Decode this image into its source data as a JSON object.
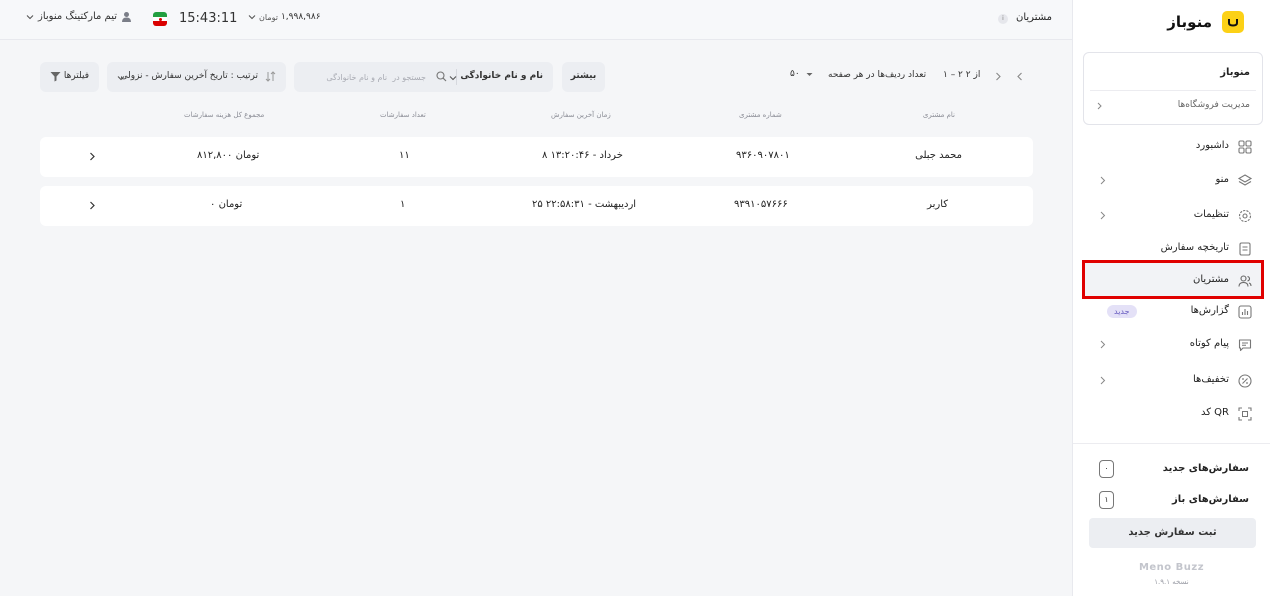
{
  "topbar": {
    "page_title": "مشتریان",
    "info_badge": "i",
    "user_name": "تیم مارکتینگ منوباز",
    "balance_value": "۱,۹۹۸,۹۸۶",
    "balance_unit": "تومان",
    "clock": "15:43:11"
  },
  "sidebar": {
    "logo_text": "منوباز",
    "store_name": "منوباز",
    "store_manage": "مدیریت فروشگاه‌ها",
    "nav": [
      {
        "label": "داشبورد",
        "icon": "dashboard-grid-icon"
      },
      {
        "label": "منو",
        "icon": "layers-icon"
      },
      {
        "label": "تنظیمات",
        "icon": "gear-icon"
      },
      {
        "label": "تاریخچه سفارش",
        "icon": "receipt-icon"
      },
      {
        "label": "مشتریان",
        "icon": "users-icon"
      },
      {
        "label": "گزارش‌ها",
        "icon": "bar-chart-icon",
        "badge": "جدید"
      },
      {
        "label": "پیام کوتاه",
        "icon": "message-icon"
      },
      {
        "label": "تخفیف‌ها",
        "icon": "discount-icon"
      },
      {
        "label": "کد QR",
        "icon": "qr-scan-icon"
      }
    ],
    "new_orders_label": "سفارش‌های جدید",
    "new_orders_count": "۰",
    "open_orders_label": "سفارش‌های باز",
    "open_orders_count": "۱",
    "new_order_button": "ثبت سفارش جدید",
    "brand_footer": "Meno Buzz",
    "version": "نسخه ۱.۹.۱"
  },
  "toolbar": {
    "filters_label": "فیلترها",
    "sort_label": "ترتیب : تاریخ آخرین سفارش - نزولی",
    "search_placeholder": "جستجو در  نام و نام خانوادگی",
    "search_field": "نام و نام خانوادگی",
    "more_label": "بیشتر",
    "pager_range": "۱ – ۲ از ۲",
    "rows_per_page_label": "تعداد ردیف‌ها در هر صفحه",
    "rows_per_page_value": "۵۰"
  },
  "table": {
    "headers": [
      "نام مشتری",
      "شماره مشتری",
      "زمان آخرین سفارش",
      "تعداد سفارشات",
      "مجموع کل هزینه سفارشات"
    ],
    "rows": [
      {
        "name": "محمد جبلی",
        "phone": "۹۳۶۰۹۰۷۸۰۱",
        "last_order": "۸ خرداد - ۱۳:۲۰:۴۶",
        "count": "۱۱",
        "total": "۸۱۲,۸۰۰ تومان"
      },
      {
        "name": "کاربر",
        "phone": "۹۳۹۱۰۵۷۶۶۶",
        "last_order": "۲۵ اردیبهشت - ۲۲:۵۸:۳۱",
        "count": "۱",
        "total": "۰ تومان"
      }
    ]
  },
  "colors": {
    "brand_yellow": "#fcd116",
    "highlight_red": "#e00000",
    "badge_purple": "#6a5fc1"
  }
}
